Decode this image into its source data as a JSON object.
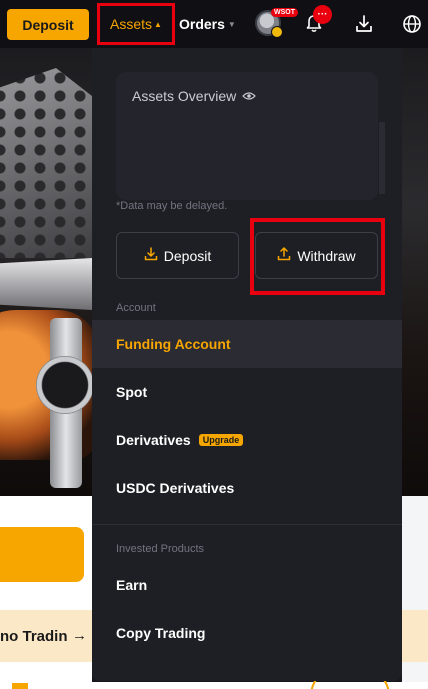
{
  "topbar": {
    "deposit_label": "Deposit",
    "assets_label": "Assets",
    "orders_label": "Orders",
    "avatar_badge": "WSOT",
    "notification_badge": "···"
  },
  "background": {
    "promo_text": "no Tradin",
    "promo_arrow": "→"
  },
  "assets_menu": {
    "overview_title": "Assets Overview",
    "delayed_note": "*Data may be delayed.",
    "deposit_label": "Deposit",
    "withdraw_label": "Withdraw",
    "account_section_label": "Account",
    "account_items": [
      {
        "label": "Funding Account",
        "active": true
      },
      {
        "label": "Spot"
      },
      {
        "label": "Derivatives",
        "badge": "Upgrade"
      },
      {
        "label": "USDC Derivatives"
      }
    ],
    "invested_section_label": "Invested Products",
    "invested_items": [
      {
        "label": "Earn"
      },
      {
        "label": "Copy Trading"
      }
    ]
  },
  "colors": {
    "brand": "#f7a600",
    "highlight": "#e8000f",
    "panel": "#1e1f25"
  },
  "icons": {
    "eye": "eye-icon",
    "bell": "bell-icon",
    "download": "download-icon",
    "globe": "globe-icon",
    "deposit": "deposit-arrow-icon",
    "withdraw": "withdraw-arrow-icon"
  }
}
